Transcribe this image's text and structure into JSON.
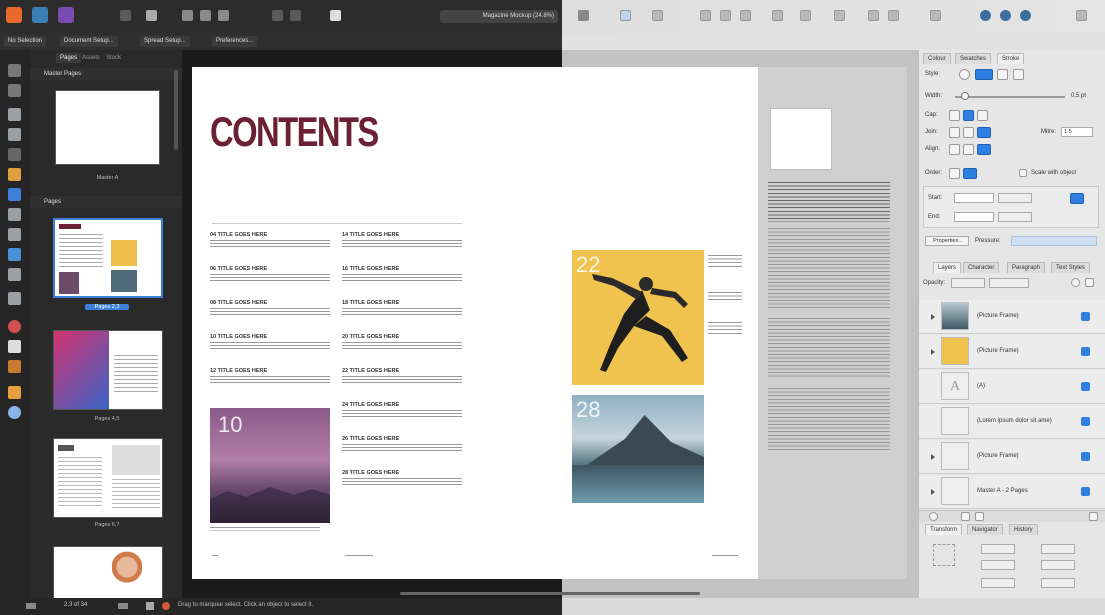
{
  "toolbar": {
    "document_title": "Magazine Mockup (24.8%)"
  },
  "context_toolbar": {
    "buttons": [
      "No Selection",
      "Document Setup...",
      "Spread Setup...",
      "Preferences..."
    ]
  },
  "pages_panel": {
    "tabs": [
      "Pages",
      "Assets",
      "Stock"
    ],
    "master_section": "Master Pages",
    "master_label": "Master A",
    "pages_section": "Pages",
    "page_labels": [
      "Pages 2,3",
      "Pages 4,5",
      "Pages 6,7"
    ]
  },
  "spread": {
    "contents_title": "CONTENTS",
    "toc_left": [
      "04 TITLE GOES HERE",
      "06 TITLE GOES HERE",
      "08 TITLE GOES HERE",
      "10 TITLE GOES HERE",
      "12 TITLE GOES HERE"
    ],
    "toc_right": [
      "14 TITLE GOES HERE",
      "16 TITLE GOES HERE",
      "18 TITLE GOES HERE",
      "20 TITLE GOES HERE",
      "22 TITLE GOES HERE",
      "24 TITLE GOES HERE",
      "26 TITLE GOES HERE",
      "28 TITLE GOES HERE"
    ],
    "feature_number_left": "10",
    "feature_number_runner": "22",
    "feature_number_mountain": "28"
  },
  "stroke_panel": {
    "tabs": [
      "Colour",
      "Swatches",
      "Stroke"
    ],
    "style_label": "Style:",
    "width_label": "Width:",
    "width_value": "0.5 pt",
    "cap_label": "Cap:",
    "join_label": "Join:",
    "mitre_label": "Mitre:",
    "mitre_value": "1.5",
    "align_label": "Align:",
    "order_label": "Order:",
    "scale_label": "Scale with object",
    "start_label": "Start:",
    "end_label": "End:",
    "properties_btn": "Properties...",
    "pressure_btn": "Pressure:"
  },
  "layers_panel": {
    "tabs": [
      "Layers",
      "Character",
      "Paragraph",
      "Text Styles"
    ],
    "opacity_label": "Opacity:",
    "layers": [
      "(Picture Frame)",
      "(Picture Frame)",
      "(A)",
      "(Lorem ipsum dolor sit ame)",
      "(Picture Frame)",
      "Master A - 2 Pages"
    ]
  },
  "transform_panel": {
    "tabs": [
      "Transform",
      "Navigator",
      "History"
    ]
  },
  "status_bar": {
    "page_indicator": "2,3 of 34",
    "hint": "Drag to marquee select. Click an object to select it."
  },
  "colors": {
    "title": "#6b2035",
    "accent": "#2f7fe0"
  }
}
